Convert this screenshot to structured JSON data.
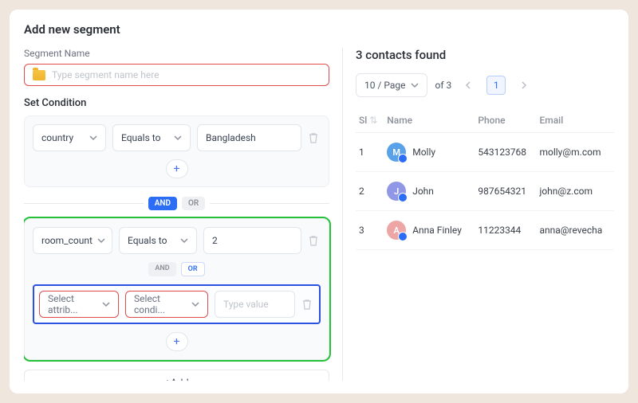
{
  "title": "Add new segment",
  "segmentName": {
    "label": "Segment Name",
    "placeholder": "Type segment name here"
  },
  "setCondition": {
    "label": "Set Condition"
  },
  "and": "AND",
  "or": "OR",
  "group1": {
    "attr": "country",
    "op": "Equals to",
    "val": "Bangladesh"
  },
  "group2a": {
    "attr": "room_count",
    "op": "Equals to",
    "val": "2"
  },
  "group2b": {
    "attrPlaceholder": "Select attrib...",
    "opPlaceholder": "Select condi...",
    "valPlaceholder": "Type value"
  },
  "addBtn": "+Add",
  "results": {
    "title": "3 contacts found",
    "perPage": "10 / Page",
    "ofText": "of 3",
    "currentPage": "1",
    "cols": {
      "sl": "Sl",
      "name": "Name",
      "phone": "Phone",
      "email": "Email"
    },
    "rows": [
      {
        "sl": "1",
        "initial": "M",
        "color": "#5aa2e8",
        "name": "Molly",
        "phone": "543123768",
        "email": "molly@m.com"
      },
      {
        "sl": "2",
        "initial": "J",
        "color": "#8f97e6",
        "name": "John",
        "phone": "987654321",
        "email": "john@z.com"
      },
      {
        "sl": "3",
        "initial": "A",
        "color": "#eda5a5",
        "name": "Anna Finley",
        "phone": "11223344",
        "email": "anna@revecha"
      }
    ]
  }
}
